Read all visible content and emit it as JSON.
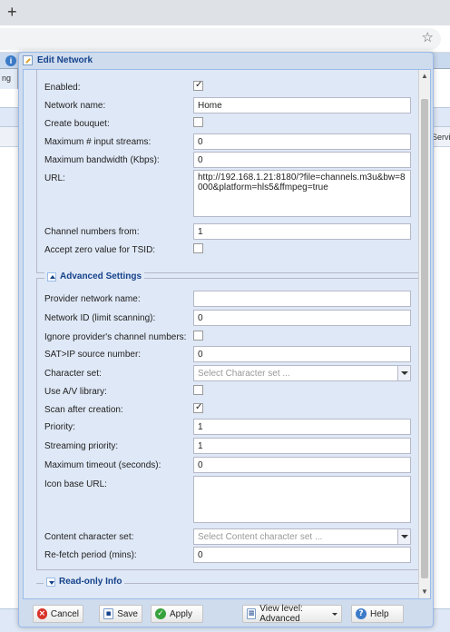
{
  "browser": {
    "new_tab_symbol": "+",
    "star_symbol": "☆"
  },
  "app": {
    "info_badge": "i",
    "left_tab_fragment": "ng",
    "column_fragment": "Servi"
  },
  "modal": {
    "title": "Edit Network",
    "basic": {
      "enabled_label": "Enabled:",
      "enabled_checked": true,
      "network_name_label": "Network name:",
      "network_name_value": "Home",
      "create_bouquet_label": "Create bouquet:",
      "create_bouquet_checked": false,
      "max_input_streams_label": "Maximum # input streams:",
      "max_input_streams_value": "0",
      "max_bandwidth_label": "Maximum bandwidth (Kbps):",
      "max_bandwidth_value": "0",
      "url_label": "URL:",
      "url_value": "http://192.168.1.21:8180/?file=channels.m3u&bw=8000&platform=hls5&ffmpeg=true",
      "channel_numbers_from_label": "Channel numbers from:",
      "channel_numbers_from_value": "1",
      "accept_zero_tsid_label": "Accept zero value for TSID:",
      "accept_zero_tsid_checked": false
    },
    "advanced": {
      "legend": "Advanced Settings",
      "provider_network_name_label": "Provider network name:",
      "provider_network_name_value": "",
      "network_id_label": "Network ID (limit scanning):",
      "network_id_value": "0",
      "ignore_channel_numbers_label": "Ignore provider's channel numbers:",
      "ignore_channel_numbers_checked": false,
      "satip_source_label": "SAT>IP source number:",
      "satip_source_value": "0",
      "character_set_label": "Character set:",
      "character_set_placeholder": "Select Character set ...",
      "use_av_library_label": "Use A/V library:",
      "use_av_library_checked": false,
      "scan_after_creation_label": "Scan after creation:",
      "scan_after_creation_checked": true,
      "priority_label": "Priority:",
      "priority_value": "1",
      "streaming_priority_label": "Streaming priority:",
      "streaming_priority_value": "1",
      "max_timeout_label": "Maximum timeout (seconds):",
      "max_timeout_value": "0",
      "icon_base_url_label": "Icon base URL:",
      "icon_base_url_value": "",
      "content_charset_label": "Content character set:",
      "content_charset_placeholder": "Select Content character set ...",
      "refetch_period_label": "Re-fetch period (mins):",
      "refetch_period_value": "0"
    },
    "readonly": {
      "legend": "Read-only Info"
    },
    "footer": {
      "cancel_label": "Cancel",
      "save_label": "Save",
      "apply_label": "Apply",
      "view_level_label": "View level: Advanced",
      "help_label": "Help"
    }
  }
}
